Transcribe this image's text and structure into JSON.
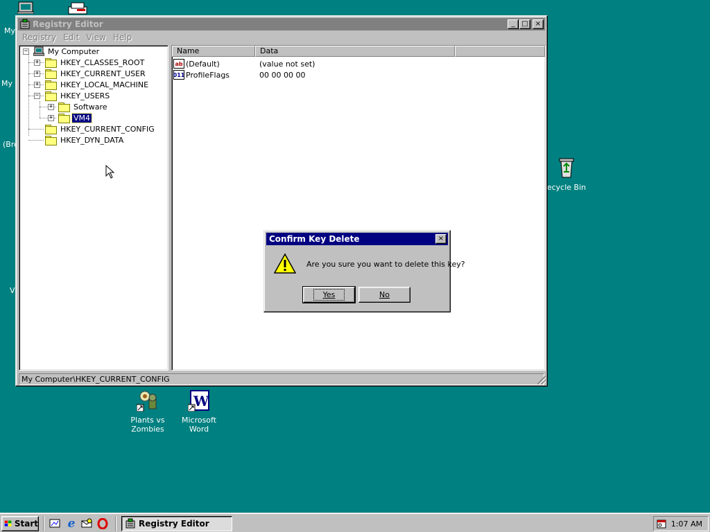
{
  "desktop": {
    "icons": [
      {
        "label": "Plants vs Zombies"
      },
      {
        "label": "Microsoft Word"
      },
      {
        "label": "ecycle Bin"
      }
    ],
    "fragments": [
      "My",
      "My D",
      "(Bro",
      "V"
    ]
  },
  "regedit": {
    "title": "Registry Editor",
    "menu": [
      "Registry",
      "Edit",
      "View",
      "Help"
    ],
    "tree": [
      {
        "label": "My Computer"
      },
      {
        "label": "HKEY_CLASSES_ROOT"
      },
      {
        "label": "HKEY_CURRENT_USER"
      },
      {
        "label": "HKEY_LOCAL_MACHINE"
      },
      {
        "label": "HKEY_USERS"
      },
      {
        "label": "Software"
      },
      {
        "label": "VM4"
      },
      {
        "label": "HKEY_CURRENT_CONFIG"
      },
      {
        "label": "HKEY_DYN_DATA"
      }
    ],
    "columns": [
      "Name",
      "Data"
    ],
    "values": [
      {
        "icon": "ab",
        "name": "(Default)",
        "data": "(value not set)"
      },
      {
        "icon": "011",
        "name": "ProfileFlags",
        "data": "00 00 00 00"
      }
    ],
    "status": "My Computer\\HKEY_CURRENT_CONFIG",
    "window_buttons": {
      "minimize": "_",
      "maximize": "□",
      "close": "×"
    }
  },
  "dialog": {
    "title": "Confirm Key Delete",
    "message": "Are you sure you want to delete this key?",
    "yes_label": "Yes",
    "no_label": "No",
    "close": "×"
  },
  "taskbar": {
    "start_label": "Start",
    "task_label": "Registry Editor",
    "clock": "1:07 AM"
  },
  "colors": {
    "desktop": "#008080",
    "active_title": "#000080",
    "inactive_title": "#808080",
    "face": "#c0c0c0"
  }
}
